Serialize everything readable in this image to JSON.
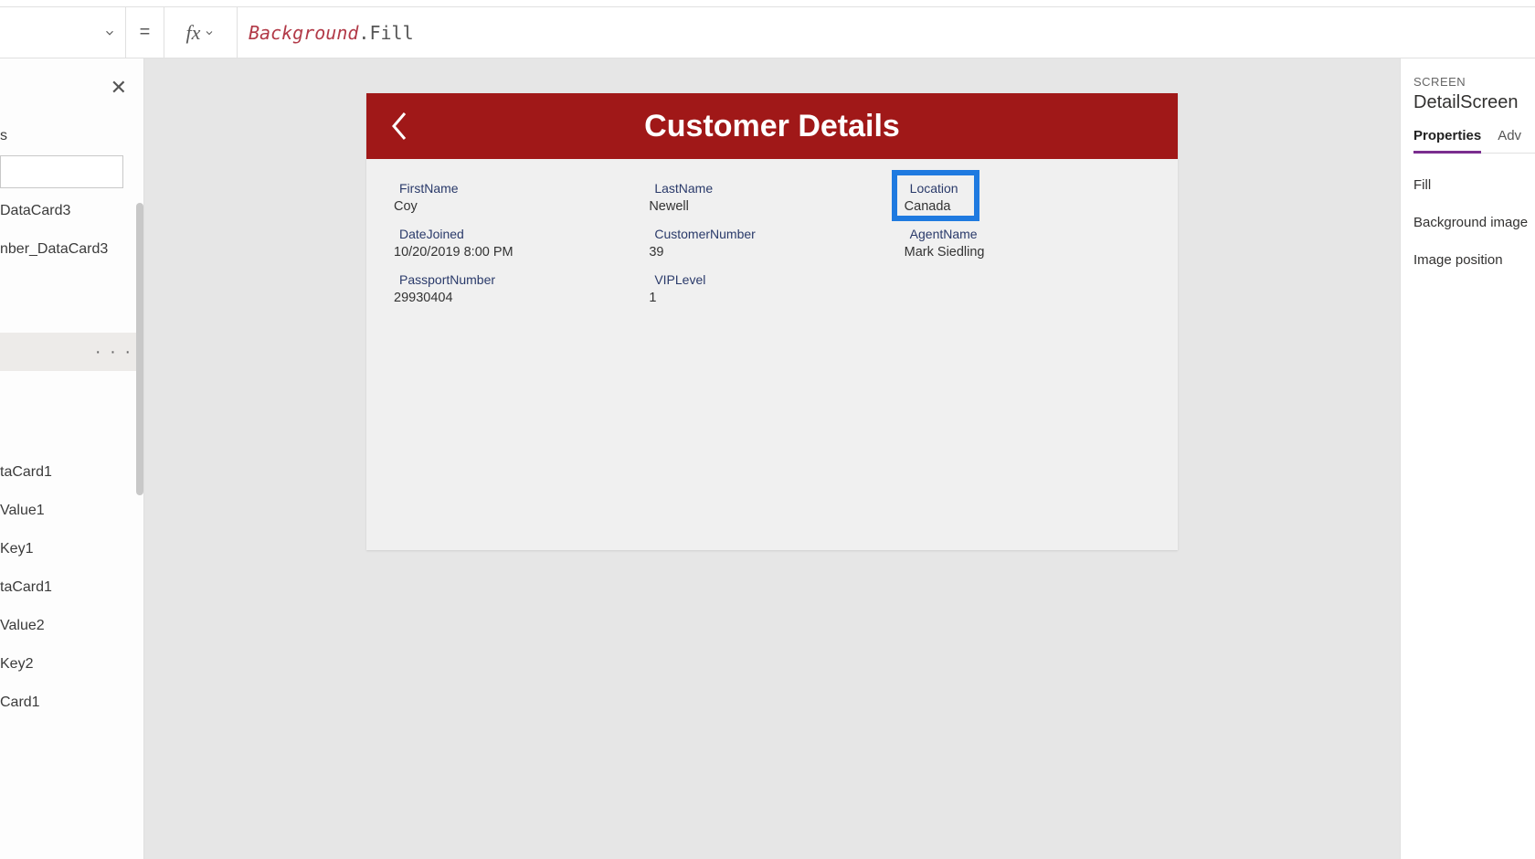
{
  "formula_bar": {
    "equals": "=",
    "fx": "fx",
    "expr_obj": "Background",
    "expr_dot": ".",
    "expr_prop": "Fill"
  },
  "left_panel": {
    "items_top": [
      "s",
      "DataCard3",
      "nber_DataCard3"
    ],
    "items_bottom": [
      "taCard1",
      "Value1",
      "Key1",
      "taCard1",
      "Value2",
      "Key2",
      "Card1"
    ],
    "selected_dots": "· · ·"
  },
  "device": {
    "title": "Customer Details",
    "cards": [
      {
        "label": "FirstName",
        "value": "Coy"
      },
      {
        "label": "LastName",
        "value": "Newell"
      },
      {
        "label": "Location",
        "value": "Canada",
        "highlighted": true
      },
      {
        "label": "DateJoined",
        "value": "10/20/2019 8:00 PM"
      },
      {
        "label": "CustomerNumber",
        "value": "39"
      },
      {
        "label": "AgentName",
        "value": "Mark Siedling"
      },
      {
        "label": "PassportNumber",
        "value": "29930404"
      },
      {
        "label": "VIPLevel",
        "value": "1"
      }
    ]
  },
  "right_panel": {
    "caption": "SCREEN",
    "name": "DetailScreen",
    "tabs": {
      "active": "Properties",
      "other": "Adv"
    },
    "rows": [
      "Fill",
      "Background image",
      "Image position"
    ]
  }
}
